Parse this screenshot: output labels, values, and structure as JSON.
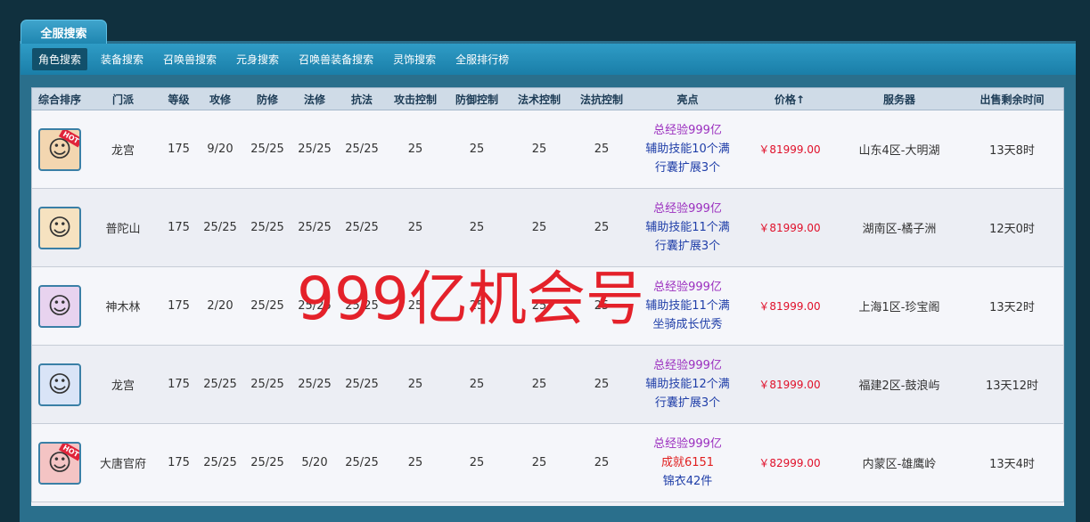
{
  "header": {
    "main_tab": "全服搜索"
  },
  "subnav": [
    "角色搜索",
    "装备搜索",
    "召唤兽搜索",
    "元身搜索",
    "召唤兽装备搜索",
    "灵饰搜索",
    "全服排行榜"
  ],
  "columns": [
    "综合排序",
    "门派",
    "等级",
    "攻修",
    "防修",
    "法修",
    "抗法",
    "攻击控制",
    "防御控制",
    "法术控制",
    "法抗控制",
    "亮点",
    "价格↑",
    "服务器",
    "出售剩余时间"
  ],
  "rows": [
    {
      "avatar": "hot-avatar-icon",
      "hot": "HOT",
      "school": "龙宫",
      "level": "175",
      "atk": "9/20",
      "def": "25/25",
      "mag": "25/25",
      "res": "25/25",
      "ac": "25",
      "dc": "25",
      "mc": "25",
      "rc": "25",
      "hl1": "总经验999亿",
      "hl2": "辅助技能10个满",
      "hl3": "行囊扩展3个",
      "price": "￥81999.00",
      "server": "山东4区-大明湖",
      "time": "13天8时"
    },
    {
      "avatar": "avatar-icon",
      "hot": "",
      "school": "普陀山",
      "level": "175",
      "atk": "25/25",
      "def": "25/25",
      "mag": "25/25",
      "res": "25/25",
      "ac": "25",
      "dc": "25",
      "mc": "25",
      "rc": "25",
      "hl1": "总经验999亿",
      "hl2": "辅助技能11个满",
      "hl3": "行囊扩展3个",
      "price": "￥81999.00",
      "server": "湖南区-橘子洲",
      "time": "12天0时"
    },
    {
      "avatar": "avatar-icon",
      "hot": "",
      "school": "神木林",
      "level": "175",
      "atk": "2/20",
      "def": "25/25",
      "mag": "25/25",
      "res": "25/25",
      "ac": "25",
      "dc": "25",
      "mc": "25",
      "rc": "25",
      "hl1": "总经验999亿",
      "hl2": "辅助技能11个满",
      "hl3": "坐骑成长优秀",
      "price": "￥81999.00",
      "server": "上海1区-珍宝阁",
      "time": "13天2时"
    },
    {
      "avatar": "avatar-icon",
      "hot": "",
      "school": "龙宫",
      "level": "175",
      "atk": "25/25",
      "def": "25/25",
      "mag": "25/25",
      "res": "25/25",
      "ac": "25",
      "dc": "25",
      "mc": "25",
      "rc": "25",
      "hl1": "总经验999亿",
      "hl2": "辅助技能12个满",
      "hl3": "行囊扩展3个",
      "price": "￥81999.00",
      "server": "福建2区-鼓浪屿",
      "time": "13天12时"
    },
    {
      "avatar": "hot-avatar-icon",
      "hot": "HOT",
      "school": "大唐官府",
      "level": "175",
      "atk": "25/25",
      "def": "25/25",
      "mag": "5/20",
      "res": "25/25",
      "ac": "25",
      "dc": "25",
      "mc": "25",
      "rc": "25",
      "hl1": "总经验999亿",
      "hl2": "成就6151",
      "hl3": "锦衣42件",
      "price": "￥82999.00",
      "server": "内蒙区-雄鹰岭",
      "time": "13天4时"
    }
  ],
  "watermark": "999亿机会号",
  "colors": {
    "accent": "#1f86b0",
    "price": "#e0102a",
    "purple": "#9b2fbf",
    "blue": "#1f3ea8"
  }
}
